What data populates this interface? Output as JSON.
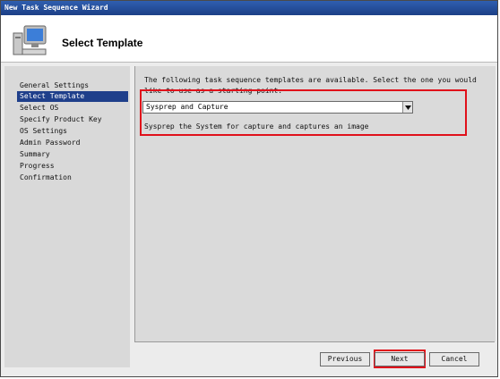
{
  "window": {
    "title": "New Task Sequence Wizard"
  },
  "header": {
    "title": "Select Template",
    "icon": "computer-monitor-icon"
  },
  "nav": {
    "items": [
      "General Settings",
      "Select Template",
      "Select OS",
      "Specify Product Key",
      "OS Settings",
      "Admin Password",
      "Summary",
      "Progress",
      "Confirmation"
    ],
    "active_index": 1
  },
  "content": {
    "intro_line1": "The following task sequence templates are available.  Select the one you would",
    "intro_line2": "like to use as a starting point.",
    "template_selected": "Sysprep and Capture",
    "template_description": "Sysprep the System for capture and captures an image"
  },
  "buttons": {
    "previous": "Previous",
    "next": "Next",
    "cancel": "Cancel"
  },
  "colors": {
    "highlight": "#e0101a",
    "nav_active": "#1f3f8b",
    "titlebar": "#1c3f86"
  }
}
